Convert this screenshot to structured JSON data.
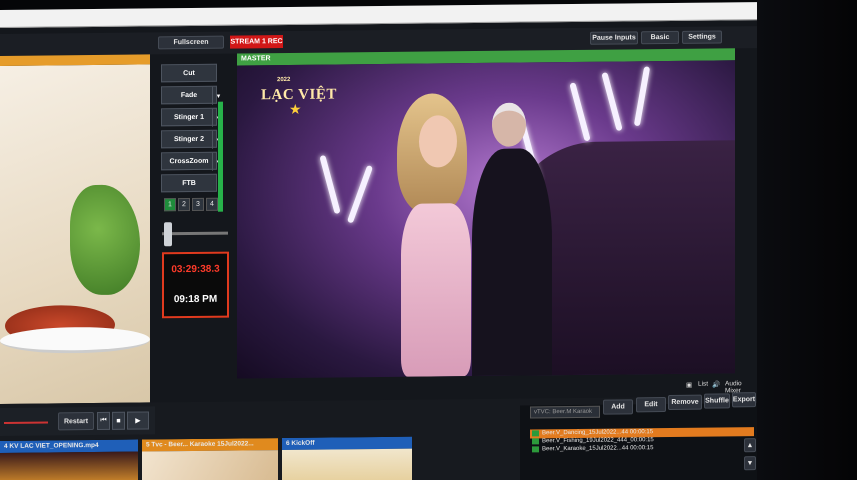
{
  "topbar": {
    "fullscreen_label": "Fullscreen",
    "stream_rec_label": "STREAM 1 REC",
    "pause_inputs_label": "Pause Inputs",
    "basic_label": "Basic",
    "settings_label": "Settings"
  },
  "transitions": {
    "cut": "Cut",
    "fade": "Fade",
    "stinger1": "Stinger 1",
    "stinger2": "Stinger 2",
    "crosszoom": "CrossZoom",
    "ftb": "FTB",
    "numbers": [
      "1",
      "2",
      "3",
      "4"
    ]
  },
  "clock": {
    "countdown": "03:29:38.3",
    "time": "09:18 PM"
  },
  "master": {
    "label": "MASTER",
    "logo_top": "2022",
    "logo_text": "LẠC VIỆT"
  },
  "playback": {
    "restart_label": "Restart"
  },
  "inputs": [
    {
      "label": "4  KV LAC VIET_OPENING.mp4",
      "color": "#1f5fb8"
    },
    {
      "label": "5  Tvc - Beer... Karaoke 15Jul2022...",
      "color": "#e08a1e"
    },
    {
      "label": "6  KickOff",
      "color": "#1f5fb8"
    }
  ],
  "list": {
    "search_placeholder": "vTVC: Beer.M Karaok",
    "list_label": "List",
    "audio_mixer_label": "Audio Mixer",
    "add_label": "Add",
    "edit_label": "Edit",
    "remove_label": "Remove",
    "shuffle_label": "Shuffle",
    "export_label": "Export",
    "items": [
      "Beer.V_Dancing_15Jul2022...44 00:00:15",
      "Beer.V_Fishing_19Jul2022_444_00:00:15",
      "Beer.V_Karaoke_15Jul2022...44 00:00:15"
    ]
  }
}
